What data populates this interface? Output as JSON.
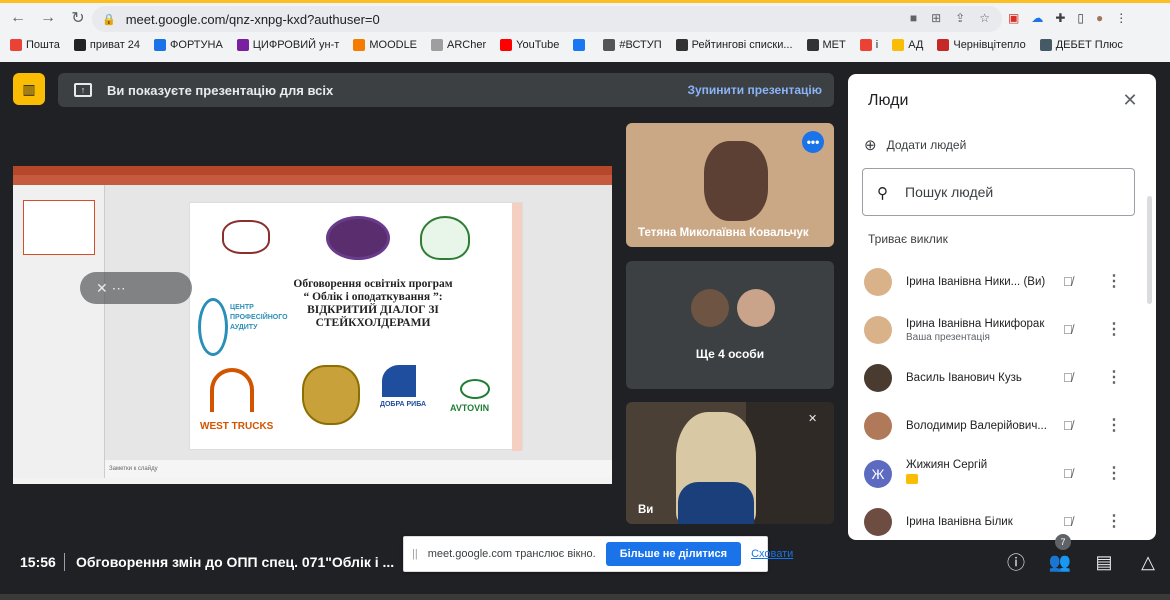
{
  "browser": {
    "url": "meet.google.com/qnz-xnpg-kxd?authuser=0",
    "bookmarks": [
      {
        "label": "Пошта",
        "color": "#ea4335"
      },
      {
        "label": "приват 24",
        "color": "#222222"
      },
      {
        "label": "ФОРТУНА",
        "color": "#1a73e8"
      },
      {
        "label": "ЦИФРОВИЙ ун-т",
        "color": "#7b1fa2"
      },
      {
        "label": "MOODLE",
        "color": "#f57c00"
      },
      {
        "label": "ARCher",
        "color": "#9e9e9e"
      },
      {
        "label": "YouTube",
        "color": "#ff0000"
      },
      {
        "label": "",
        "color": "#1877f2"
      },
      {
        "label": "#ВСТУП",
        "color": "#555555"
      },
      {
        "label": "Рейтингові списки...",
        "color": "#333333"
      },
      {
        "label": "МЕТ",
        "color": "#333333"
      },
      {
        "label": "і",
        "color": "#ea4335"
      },
      {
        "label": "АД",
        "color": "#fbbc04"
      },
      {
        "label": "Чернівцітепло",
        "color": "#c62828"
      },
      {
        "label": "ДЕБЕТ Плюс",
        "color": "#455a64"
      }
    ]
  },
  "banner": {
    "text": "Ви показуєте презентацію для всіх",
    "stop": "Зупинити презентацію"
  },
  "slide": {
    "heading_lines": [
      "Обговорення освітніх програм",
      "“ Облік і оподаткування ”:",
      "ВІДКРИТИЙ ДІАЛОГ ЗІ",
      "СТЕЙКХОЛДЕРАМИ"
    ],
    "notes": "Заметки к слайду",
    "logo_center": "ЦЕНТР ПРОФЕСІЙНОГО АУДИТУ",
    "logo_west": "WEST TRUCKS",
    "logo_dobra": "ДОБРА РИБА",
    "logo_avtovin": "AVTOVIN"
  },
  "tiles": {
    "tile1_name": "Тетяна Миколаївна Ковальчук",
    "tile2_more": "Ще 4 особи",
    "tile3_name": "Ви"
  },
  "panel": {
    "title": "Люди",
    "add_people": "Додати людей",
    "search_placeholder": "Пошук людей",
    "section": "Триває виклик",
    "people": [
      {
        "name": "Ірина Іванівна Ники...  (Ви)",
        "sub": "",
        "avatar": "#d9b28a",
        "initial": ""
      },
      {
        "name": "Ірина Іванівна Никифорак",
        "sub": "Ваша презентація",
        "avatar": "#d9b28a",
        "initial": ""
      },
      {
        "name": "Василь Іванович Кузь",
        "sub": "",
        "avatar": "#4a3b30",
        "initial": ""
      },
      {
        "name": "Володимир Валерійович...",
        "sub": "",
        "avatar": "#b07a5a",
        "initial": ""
      },
      {
        "name": "Жижиян Сергій",
        "sub": "",
        "avatar": "#5c6bc0",
        "initial": "Ж"
      },
      {
        "name": "Ірина Іванівна Білик",
        "sub": "",
        "avatar": "#6d4c41",
        "initial": ""
      }
    ]
  },
  "bottom": {
    "time": "15:56",
    "title": "Обговорення змін до ОПП спец. 071\"Облік і ...",
    "participants_count": "7"
  },
  "share_notice": {
    "text": "meet.google.com транслює вікно.",
    "stop": "Більше не ділитися",
    "hide": "Сховати"
  }
}
